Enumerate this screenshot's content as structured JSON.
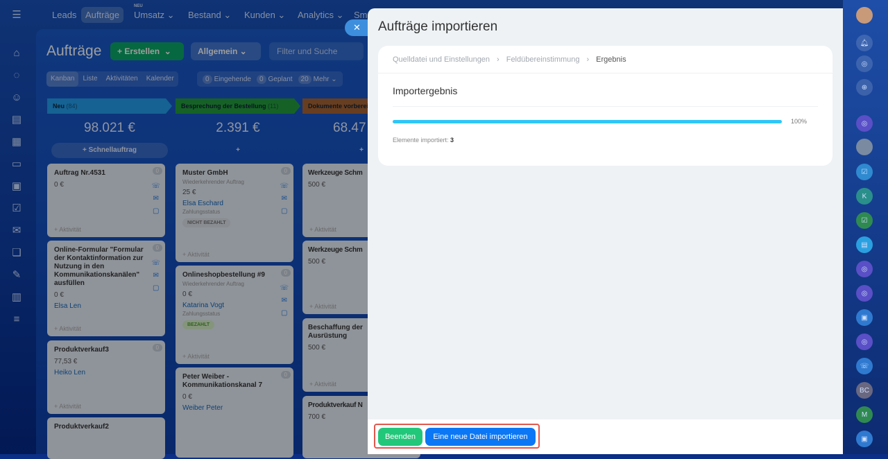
{
  "topnav": {
    "items": [
      "Leads",
      "Aufträge",
      "Umsatz ⌄",
      "Bestand ⌄",
      "Kunden ⌄",
      "Analytics ⌄",
      "Sm"
    ],
    "new_badge": "NEU"
  },
  "page": {
    "title": "Aufträge",
    "create": "+ Erstellen  ⌄",
    "filter": "Allgemein ⌄",
    "search_placeholder": "Filter und Suche"
  },
  "views": [
    "Kanban",
    "Liste",
    "Aktivitäten",
    "Kalender"
  ],
  "counters": [
    {
      "n": "0",
      "label": "Eingehende"
    },
    {
      "n": "0",
      "label": "Geplant"
    },
    {
      "n": "20",
      "label": "Mehr ⌄"
    }
  ],
  "columns": [
    {
      "title": "Neu",
      "count": "(84)",
      "sum": "98.021 €",
      "button": "+ Schnellauftrag",
      "color": "#2f9be0"
    },
    {
      "title": "Besprechung der Bestellung",
      "count": "(11)",
      "sum": "2.391 €",
      "button": "+",
      "color": "#2f9a46"
    },
    {
      "title": "Dokumente vorbereiten",
      "count": "",
      "sum": "68.47",
      "button": "+",
      "color": "#a0653c"
    }
  ],
  "cards": [
    {
      "title": "Auftrag Nr.4531",
      "price": "0 €",
      "count": "0",
      "activity": "+ Aktivität"
    },
    {
      "title": "Online-Formular \"Formular der Kontaktinformation zur Nutzung in den Kommunikationskanälen\" ausfüllen",
      "price": "0 €",
      "name": "Elsa Len",
      "count": "0",
      "activity": "+ Aktivität"
    },
    {
      "title": "Produktverkauf3",
      "price": "77,53 €",
      "name": "Heiko Len",
      "count": "0",
      "activity": "+ Aktivität"
    },
    {
      "title": "Produktverkauf2"
    },
    {
      "title": "Muster GmbH",
      "sub": "Wiederkehrender Auftrag",
      "price": "25 €",
      "name": "Elsa Eschard",
      "status_label": "Zahlungsstatus",
      "badge": "NICHT BEZAHLT",
      "count": "0",
      "activity": "+ Aktivität"
    },
    {
      "title": "Onlineshopbestellung #9",
      "sub": "Wiederkehrender Auftrag",
      "price": "0 €",
      "name": "Katarina Vogt",
      "status_label": "Zahlungsstatus",
      "badge": "BEZAHLT",
      "count": "0",
      "activity": "+ Aktivität"
    },
    {
      "title": "Peter Weiber - Kommunikationskanal 7",
      "price": "0 €",
      "name": "Weiber Peter",
      "count": "0"
    },
    {
      "title": "Werkzeuge Schm",
      "price": "500 €",
      "activity": "+ Aktivität"
    },
    {
      "title": "Werkzeuge Schm",
      "price": "500 €",
      "activity": "+ Aktivität"
    },
    {
      "title": "Beschaffung der Ausrüstung",
      "price": "500 €",
      "activity": "+ Aktivität"
    },
    {
      "title": "Produktverkauf N",
      "price": "700 €"
    }
  ],
  "rightbar": {
    "initials": [
      "K",
      "BC",
      "M"
    ]
  },
  "panel": {
    "title": "Aufträge importieren",
    "steps": [
      "Quelldatei und Einstellungen",
      "Feldübereinstimmung",
      "Ergebnis"
    ],
    "result_title": "Importergebnis",
    "progress_percent": 100,
    "progress_label": "100%",
    "imported_label": "Elemente importiert:",
    "imported_count": "3",
    "finish_button": "Beenden",
    "new_import_button": "Eine neue Datei importieren"
  }
}
